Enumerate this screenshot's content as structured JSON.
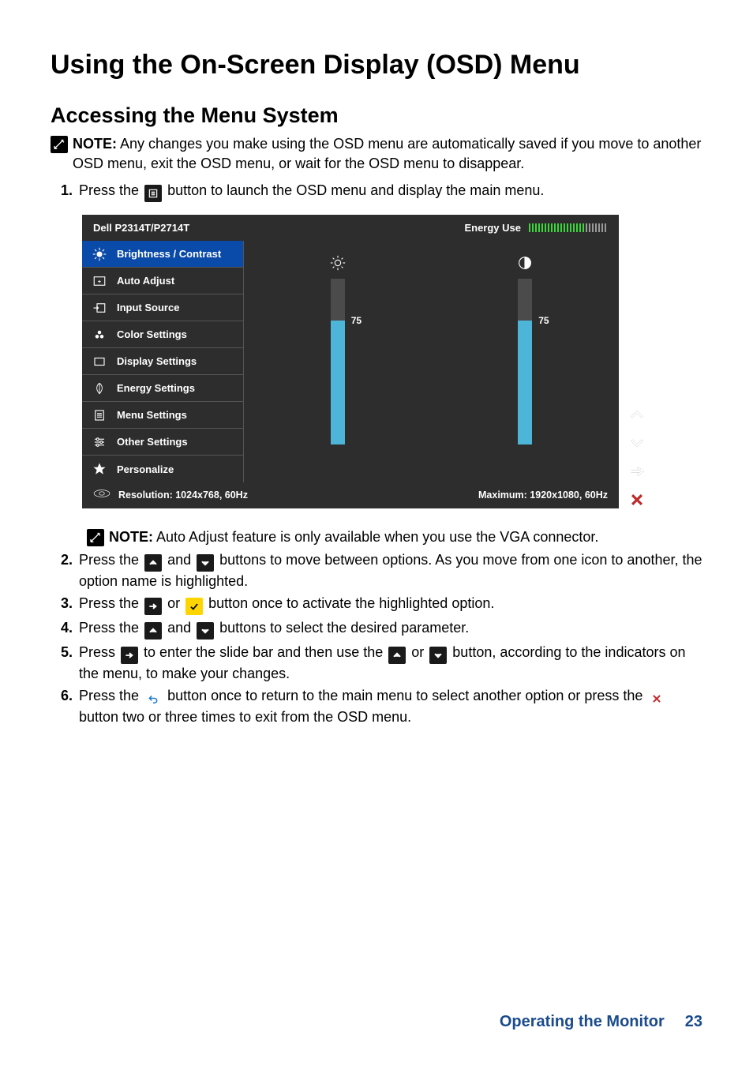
{
  "page": {
    "title": "Using the On-Screen Display (OSD) Menu",
    "subtitle": "Accessing the Menu System"
  },
  "note1": {
    "label": "NOTE:",
    "text": "Any changes you make using the OSD menu are automatically saved if you move to another OSD menu, exit the OSD menu, or wait for the OSD menu to disappear."
  },
  "steps": {
    "s1": {
      "num": "1.",
      "pre": "Press the ",
      "post": " button to launch the OSD menu and display the main menu."
    },
    "s2": {
      "num": "2.",
      "a": "Press the ",
      "b": " and ",
      "c": " buttons to move between options. As you move from one icon to another, the option name is highlighted."
    },
    "s3": {
      "num": "3.",
      "a": "Press the ",
      "b": " or ",
      "c": " button once to activate the highlighted option."
    },
    "s4": {
      "num": "4.",
      "a": "Press the ",
      "b": " and ",
      "c": " buttons to select the desired parameter."
    },
    "s5": {
      "num": "5.",
      "a": "Press ",
      "b": " to enter the slide bar and then use the ",
      "c": " or ",
      "d": " button, according to the indicators on the menu, to make your changes."
    },
    "s6": {
      "num": "6.",
      "a": "Press the ",
      "b": " button once to return to the main menu to select another option or press the ",
      "c": " button two or three times to exit from the OSD menu."
    }
  },
  "note2": {
    "label": "NOTE:",
    "text": "Auto Adjust feature is only available when you use the VGA connector."
  },
  "osd": {
    "model": "Dell P2314T/P2714T",
    "energy_label": "Energy Use",
    "menu": {
      "brightness": "Brightness / Contrast",
      "auto": "Auto Adjust",
      "input": "Input Source",
      "color": "Color Settings",
      "display": "Display Settings",
      "energy": "Energy Settings",
      "menuset": "Menu Settings",
      "other": "Other Settings",
      "personalize": "Personalize"
    },
    "brightness_val": "75",
    "contrast_val": "75",
    "res_label": "Resolution:  1024x768, 60Hz",
    "max_label": "Maximum: 1920x1080, 60Hz"
  },
  "footer": {
    "section": "Operating the Monitor",
    "page": "23"
  }
}
